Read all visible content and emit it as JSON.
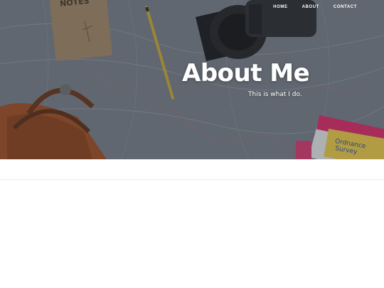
{
  "nav": {
    "items": [
      {
        "label": "HOME"
      },
      {
        "label": "ABOUT"
      },
      {
        "label": "CONTACT"
      }
    ]
  },
  "hero": {
    "title": "About Me",
    "subtitle": "This is what I do."
  },
  "photo": {
    "notebook_label": "NOTES",
    "map_label_1": "Ordnance",
    "map_label_2": "Survey"
  },
  "colors": {
    "nav_text": "#ffffff",
    "hero_text": "#ffffff",
    "bag": "#a0532a",
    "pencil": "#c9a93a",
    "map_pink": "#d8306a",
    "map_yellow": "#e8c94c"
  }
}
